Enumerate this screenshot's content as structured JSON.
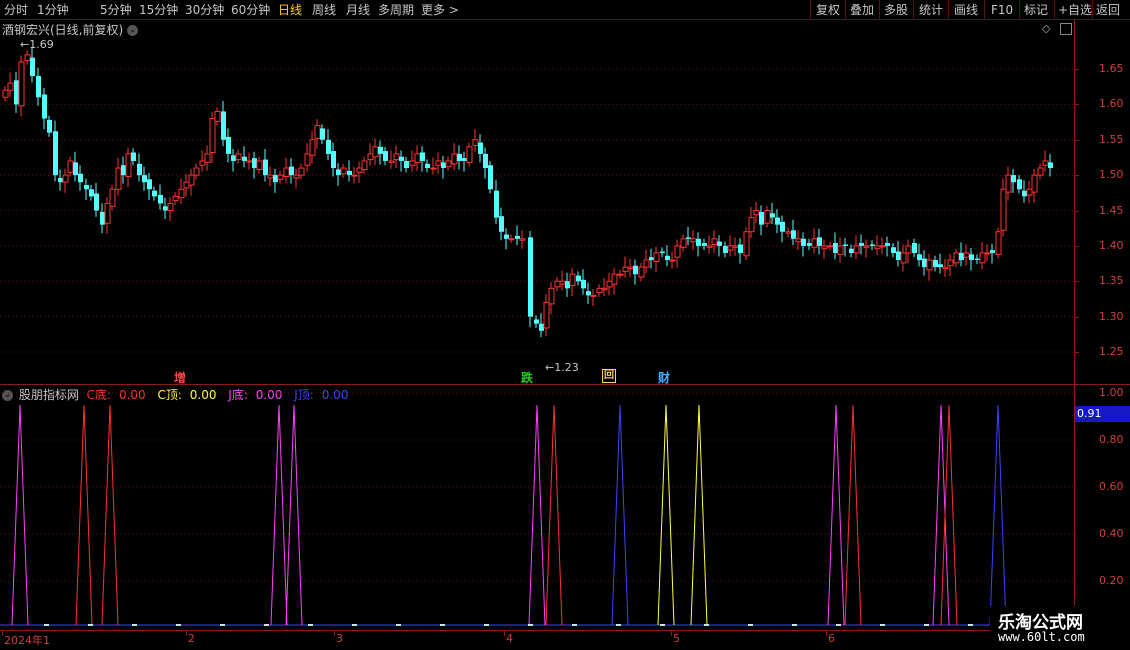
{
  "toolbar": {
    "periods": [
      "分时",
      "1分钟",
      "5分钟",
      "15分钟",
      "30分钟",
      "60分钟",
      "日线",
      "周线",
      "月线",
      "多周期",
      "更多 >"
    ],
    "active_period": "日线",
    "actions": [
      "复权",
      "叠加",
      "多股",
      "统计",
      "画线",
      "F10",
      "标记",
      "+自选",
      "返回"
    ]
  },
  "main_chart": {
    "title": "酒钢宏兴(日线,前复权)",
    "high_label": "1.69",
    "low_label": "1.23",
    "price_ticks": [
      "1.65",
      "1.60",
      "1.55",
      "1.50",
      "1.45",
      "1.40",
      "1.35",
      "1.30",
      "1.25"
    ],
    "markers": [
      {
        "text": "增",
        "color": "#ff4040"
      },
      {
        "text": "跌",
        "color": "#20d020"
      },
      {
        "text": "回",
        "color": "#ffd060"
      },
      {
        "text": "财",
        "color": "#40b0ff"
      }
    ]
  },
  "indicator": {
    "name": "股朋指标网",
    "fields": [
      {
        "label": "C底:",
        "value": "0.00",
        "color": "#ff3030"
      },
      {
        "label": "C顶:",
        "value": "0.00",
        "color": "#ffff40"
      },
      {
        "label": "J底:",
        "value": "0.00",
        "color": "#ff40ff"
      },
      {
        "label": "J顶:",
        "value": "0.00",
        "color": "#4040ff"
      }
    ],
    "ticks": [
      "1.00",
      "0.80",
      "0.60",
      "0.40",
      "0.20"
    ],
    "current_value": "0.91"
  },
  "date_axis": [
    "2024年1",
    "2",
    "3",
    "4",
    "5",
    "6"
  ],
  "watermark": {
    "title": "乐淘公式网",
    "url": "www.60lt.com"
  },
  "colors": {
    "up": "#ff3232",
    "down": "#54ffff",
    "axis": "#8b1a1a"
  }
}
